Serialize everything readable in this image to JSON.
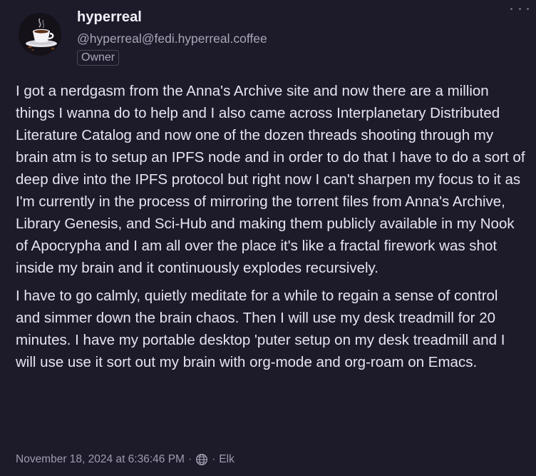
{
  "post": {
    "author": {
      "display_name": "hyperreal",
      "handle": "@hyperreal@fedi.hyperreal.coffee",
      "role_badge": "Owner",
      "avatar_icon": "coffee-cup-avatar"
    },
    "menu_icon": "more-options-icon",
    "paragraphs": [
      "I got a nerdgasm from the Anna's Archive site and now there are a million things I wanna do to help and I also came across Interplanetary Distributed Literature Catalog and now one of the dozen threads shooting through my brain atm is to setup an IPFS node and in order to do that I have to do a sort of deep dive into the IPFS protocol but right now I can't sharpen my focus to it as I'm currently in the process of mirroring the torrent files from Anna's Archive, Library Genesis, and Sci-Hub and making them publicly available in my Nook of Apocrypha and I am all over the place it's like a fractal firework was shot inside my brain and it continuously explodes recursively.",
      "I have to go calmly, quietly meditate for a while to regain a sense of control and simmer down the brain chaos. Then I will use my desk treadmill for 20 minutes. I have my portable desktop 'puter setup on my desk treadmill and I will use use it sort out my brain with org-mode and org-roam on Emacs."
    ],
    "footer": {
      "timestamp": "November 18, 2024 at 6:36:46 PM",
      "separator": "·",
      "visibility_icon": "globe-icon",
      "client": "Elk"
    }
  },
  "colors": {
    "background": "#1d1b2a",
    "text": "#e6e4ee",
    "muted": "#a9a6b8"
  }
}
